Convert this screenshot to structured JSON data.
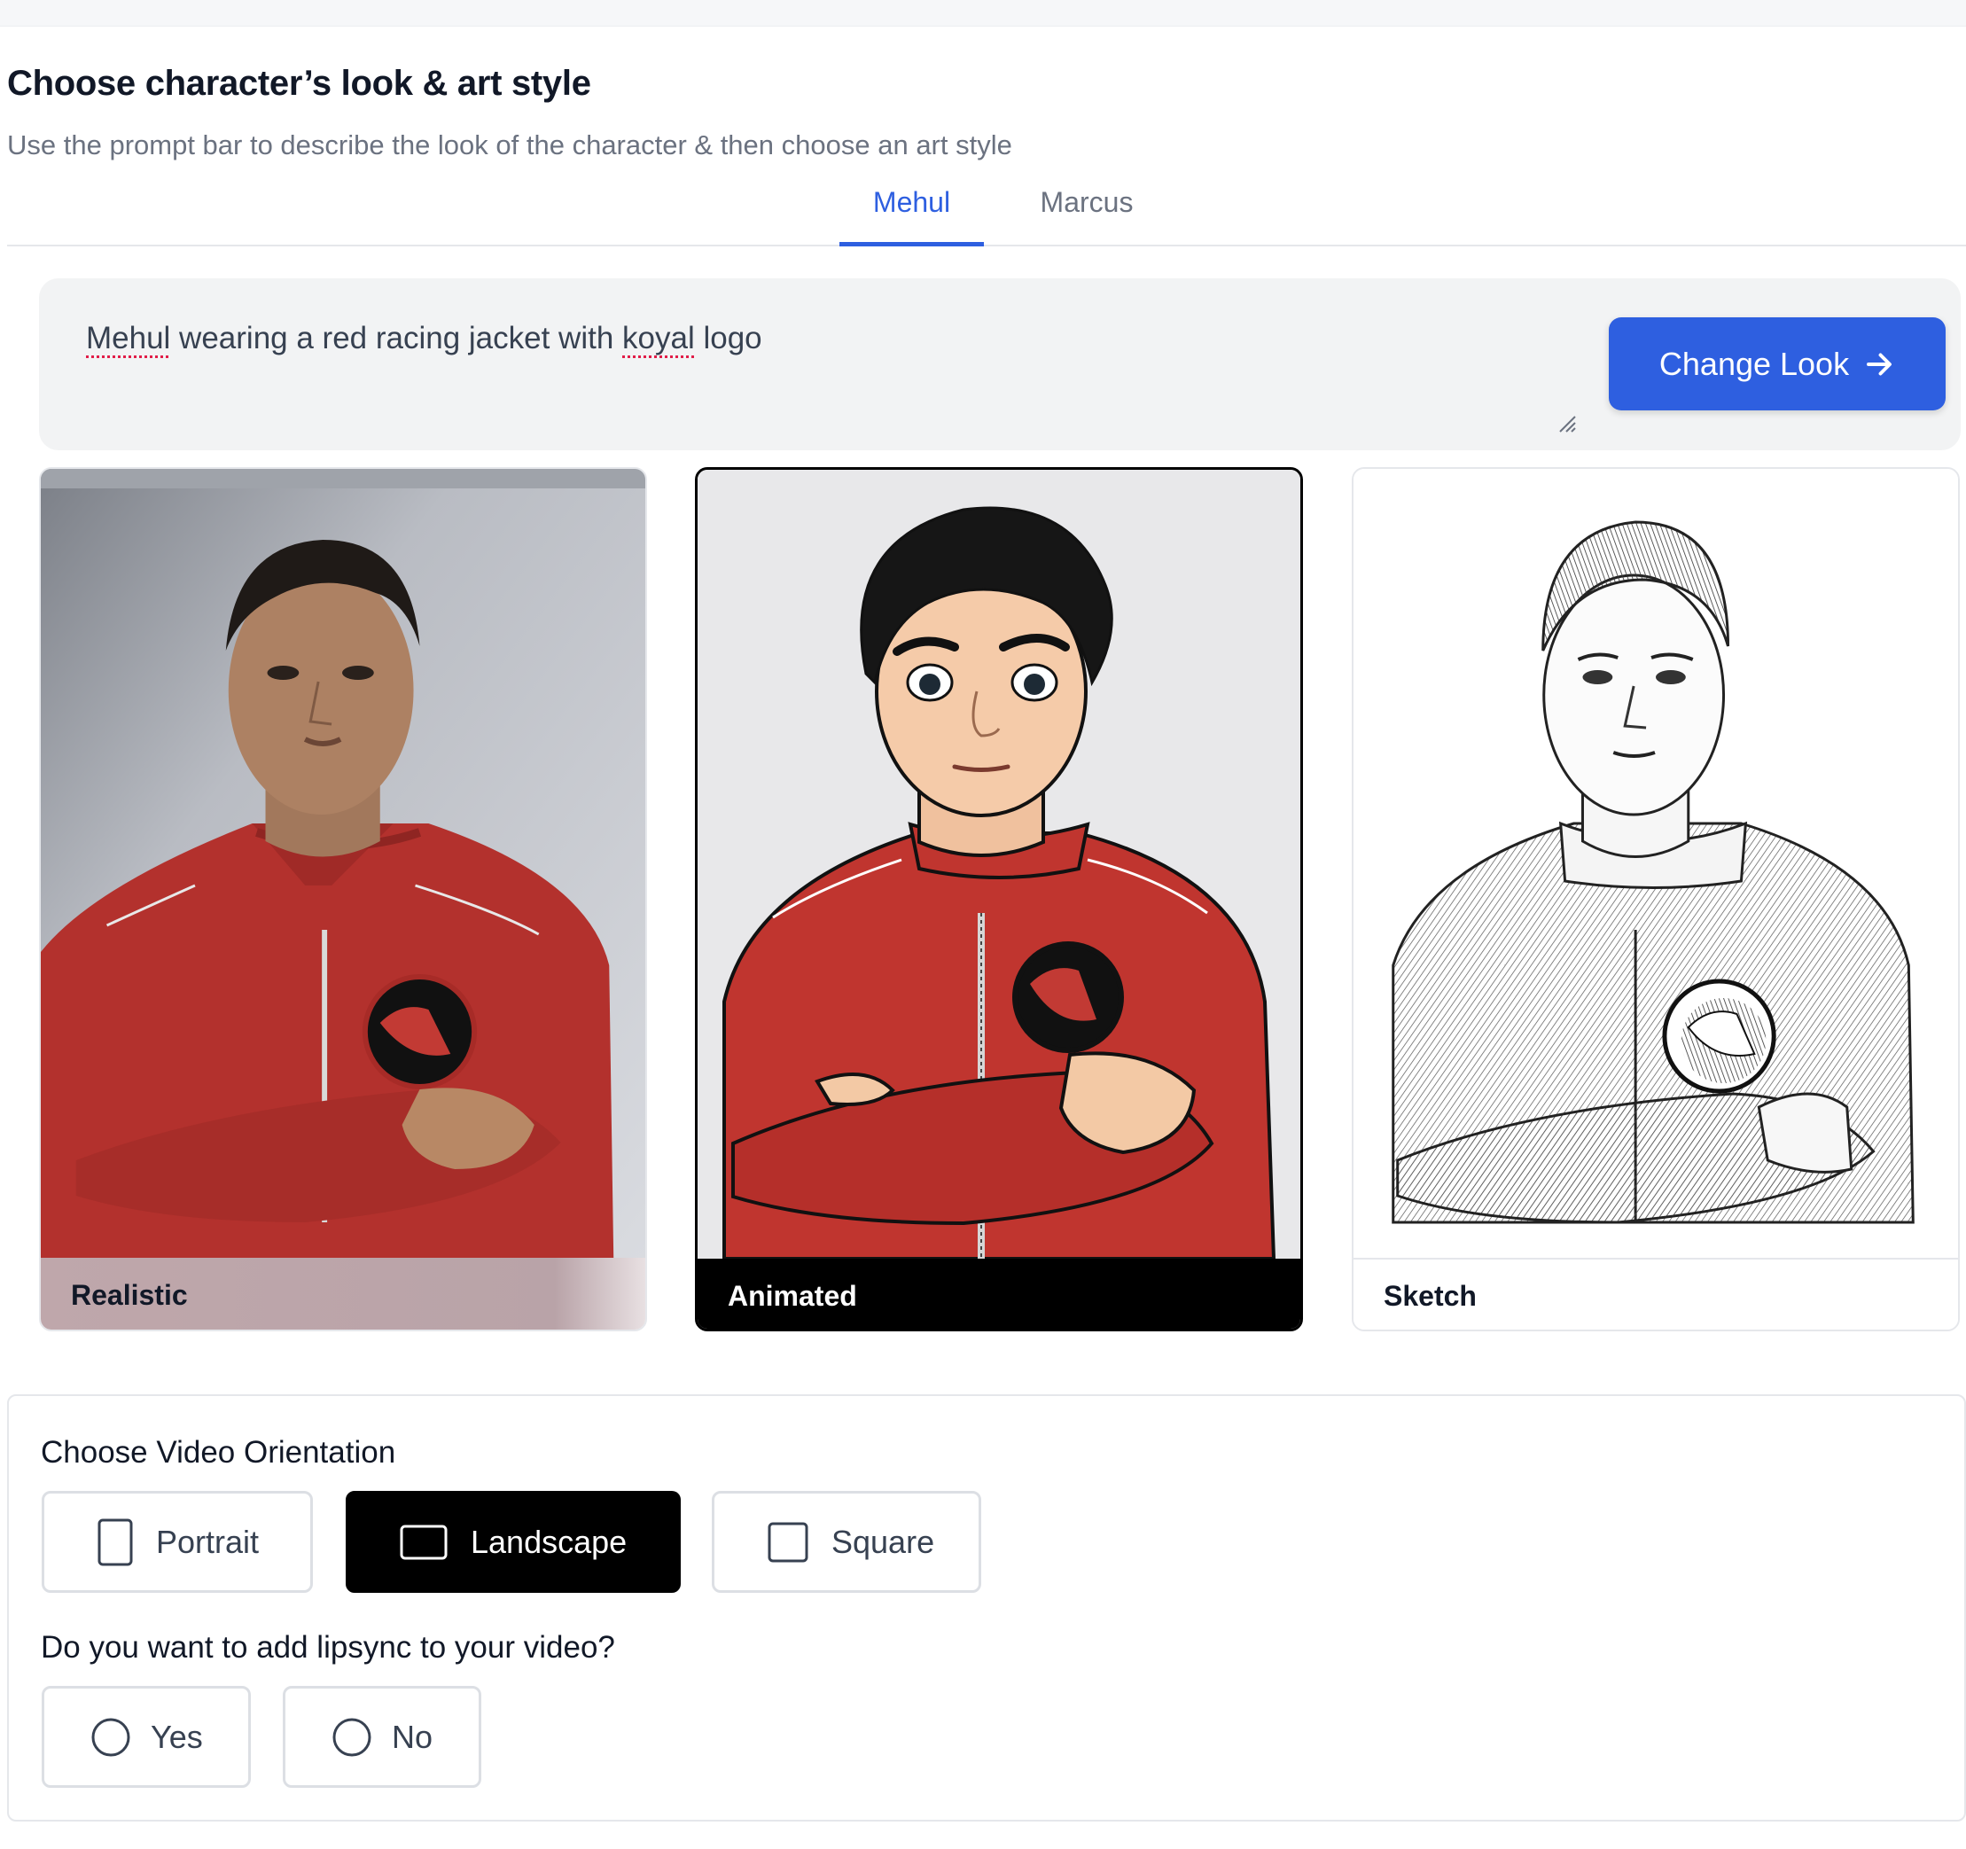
{
  "header": {
    "title": "Choose character’s look & art style",
    "subtitle": "Use the prompt bar to describe the look of the character & then choose an art style"
  },
  "tabs": [
    {
      "label": "Mehul",
      "active": true
    },
    {
      "label": "Marcus",
      "active": false
    }
  ],
  "prompt": {
    "word_name": "Mehul",
    "text_mid": " wearing a red racing jacket with ",
    "word_brand": "koyal",
    "text_end": " logo",
    "button_label": "Change Look",
    "button_icon": "arrow-right-icon"
  },
  "styles": [
    {
      "label": "Realistic",
      "selected": false
    },
    {
      "label": "Animated",
      "selected": true
    },
    {
      "label": "Sketch",
      "selected": false
    }
  ],
  "orientation": {
    "label": "Choose Video Orientation",
    "options": [
      {
        "label": "Portrait",
        "icon": "portrait-rectangle-icon",
        "selected": false
      },
      {
        "label": "Landscape",
        "icon": "landscape-rectangle-icon",
        "selected": true
      },
      {
        "label": "Square",
        "icon": "square-icon",
        "selected": false
      }
    ]
  },
  "lipsync": {
    "label": "Do you want to add lipsync to your video?",
    "options": [
      {
        "label": "Yes",
        "icon": "radio-icon",
        "selected": false
      },
      {
        "label": "No",
        "icon": "radio-icon",
        "selected": false
      }
    ]
  },
  "colors": {
    "accent": "#2e5fe0",
    "selected": "#000000",
    "jacket_red": "#c0352f"
  }
}
